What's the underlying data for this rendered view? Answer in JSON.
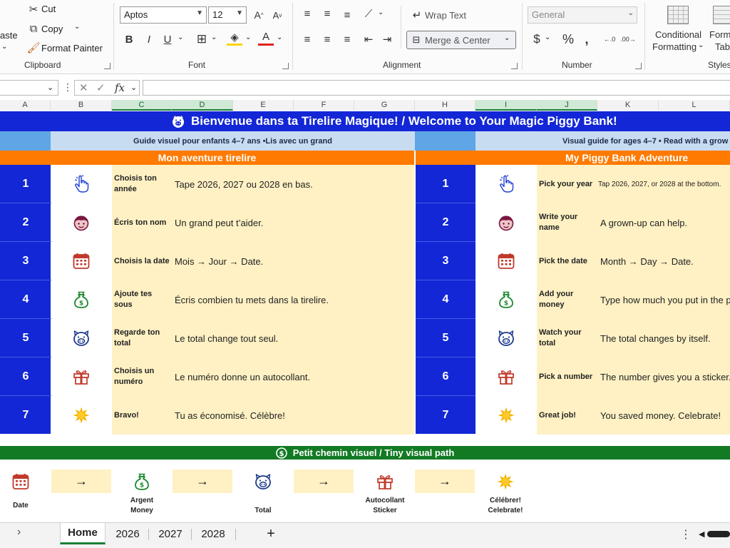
{
  "ribbon": {
    "clipboard": {
      "paste_label": "aste",
      "cut_label": "Cut",
      "copy_label": "Copy",
      "format_painter_label": "Format Painter",
      "group_label": "Clipboard"
    },
    "font": {
      "font_name": "Aptos",
      "font_size": "12",
      "group_label": "Font"
    },
    "alignment": {
      "wrap_text_label": "Wrap Text",
      "merge_center_label": "Merge & Center",
      "group_label": "Alignment"
    },
    "number": {
      "format": "General",
      "group_label": "Number"
    },
    "styles": {
      "conditional_formatting_label": "Conditional",
      "conditional_formatting_label2": "Formatting",
      "format_table_label": "Form",
      "format_table_label2": "Tab",
      "group_label": "Styles"
    }
  },
  "formula_bar": {
    "fx": "fx",
    "value": ""
  },
  "columns": [
    "A",
    "B",
    "C",
    "D",
    "E",
    "F",
    "G",
    "H",
    "I",
    "J",
    "K",
    "L"
  ],
  "sheet": {
    "title": "Bienvenue dans ta Tirelire Magique!  /  Welcome to Your Magic Piggy Bank!",
    "fr_subtitle": "Guide visuel pour enfants 4–7 ans •Lis avec un grand",
    "en_subtitle": "Visual guide for ages 4–7  • Read with a grow",
    "fr_heading": "Mon aventure tirelire",
    "en_heading": "My Piggy Bank Adventure",
    "steps": [
      {
        "num": "1",
        "icon": "pointing-hand-icon",
        "fr_label": "Choisis ton année",
        "fr_text": "Tape 2026, 2027 ou 2028 en bas.",
        "en_label": "Pick your year",
        "en_text": "Tap 2026, 2027, or 2028 at the bottom."
      },
      {
        "num": "2",
        "icon": "child-face-icon",
        "fr_label": "Écris ton nom",
        "fr_text": "Un grand peut t’aider.",
        "en_label": "Write your name",
        "en_text": "A grown-up can help."
      },
      {
        "num": "3",
        "icon": "calendar-icon",
        "fr_label": "Choisis la date",
        "fr_text": "Mois → Jour → Date.",
        "en_label": "Pick the date",
        "en_text": "Month → Day → Date."
      },
      {
        "num": "4",
        "icon": "money-bag-icon",
        "fr_label": "Ajoute tes sous",
        "fr_text": "Écris combien tu mets dans la tirelire.",
        "en_label": "Add your money",
        "en_text": "Type how much you put in the p"
      },
      {
        "num": "5",
        "icon": "pig-face-icon",
        "fr_label": "Regarde ton total",
        "fr_text": "Le total change tout seul.",
        "en_label": "Watch your total",
        "en_text": "The total changes by itself."
      },
      {
        "num": "6",
        "icon": "gift-icon",
        "fr_label": "Choisis un numéro",
        "fr_text": "Le numéro donne un autocollant.",
        "en_label": "Pick a number",
        "en_text": "The number gives you a sticker."
      },
      {
        "num": "7",
        "icon": "sparkle-sun-icon",
        "fr_label": "Bravo!",
        "fr_text": "Tu as économisé. Célèbre!",
        "en_label": "Great job!",
        "en_text": "You saved money. Celebrate!"
      }
    ],
    "path_heading": "Petit chemin visuel / Tiny visual path",
    "path": [
      {
        "icon": "calendar-icon",
        "label": "Date"
      },
      {
        "icon": "money-bag-icon",
        "label": "Argent\nMoney"
      },
      {
        "icon": "pig-face-icon",
        "label": "Total"
      },
      {
        "icon": "gift-icon",
        "label": "Autocollant\nSticker"
      },
      {
        "icon": "sparkle-sun-icon",
        "label": "Célébrer!\nCelebrate!"
      }
    ],
    "arrow": "→"
  },
  "tabs": [
    "Home",
    "2026",
    "2027",
    "2028"
  ],
  "active_tab": "Home",
  "add_sheet": "+",
  "colors": {
    "blue": "#1327d6",
    "orange": "#ff7a00",
    "green": "#137a24",
    "cream": "#fff1c4",
    "light_blue": "#c7dcf1"
  }
}
